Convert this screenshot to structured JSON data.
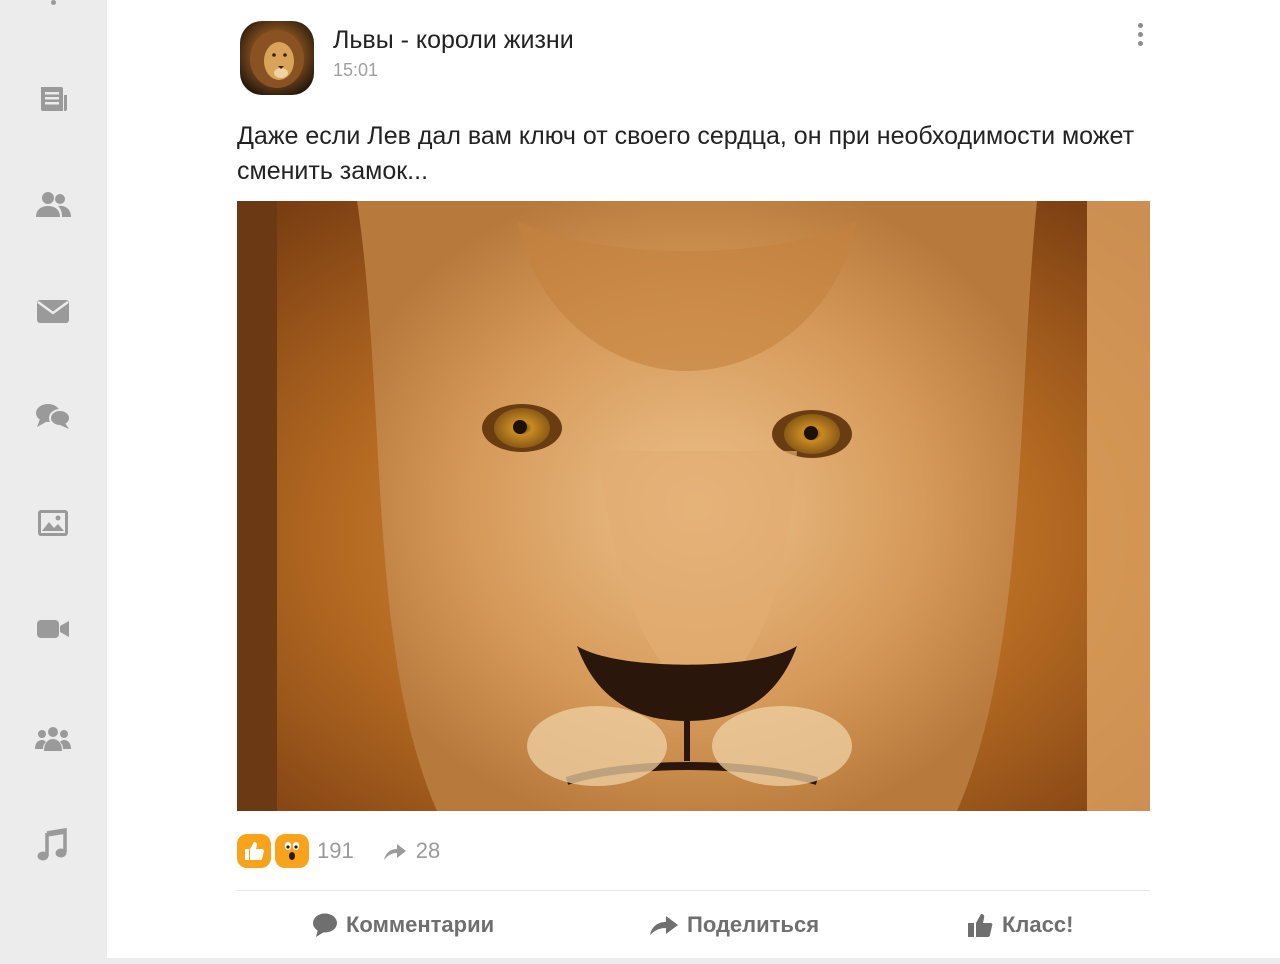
{
  "sidebar": {
    "items": [
      {
        "icon": "news-feed-icon"
      },
      {
        "icon": "friends-icon"
      },
      {
        "icon": "messages-icon"
      },
      {
        "icon": "discussions-icon"
      },
      {
        "icon": "photos-icon"
      },
      {
        "icon": "video-icon"
      },
      {
        "icon": "groups-icon"
      },
      {
        "icon": "music-icon"
      }
    ],
    "icon_color": "#9a9a9a"
  },
  "post": {
    "group_name": "Львы - короли жизни",
    "time": "15:01",
    "text": "Даже если Лев дал вам ключ от своего сердца, он при необходимости может сменить замок...",
    "image_alt": "lion-face-photo",
    "reactions": {
      "icons": [
        "like-reaction-icon",
        "wow-reaction-icon"
      ],
      "count": "191"
    },
    "shares": {
      "icon": "share-arrow-icon",
      "count": "28"
    }
  },
  "actions": {
    "comments_label": "Комментарии",
    "share_label": "Поделиться",
    "like_label": "Класс!"
  },
  "colors": {
    "accent": "#f8a31b",
    "sidebar_bg": "#ececec",
    "muted_text": "#9a9a9a"
  }
}
